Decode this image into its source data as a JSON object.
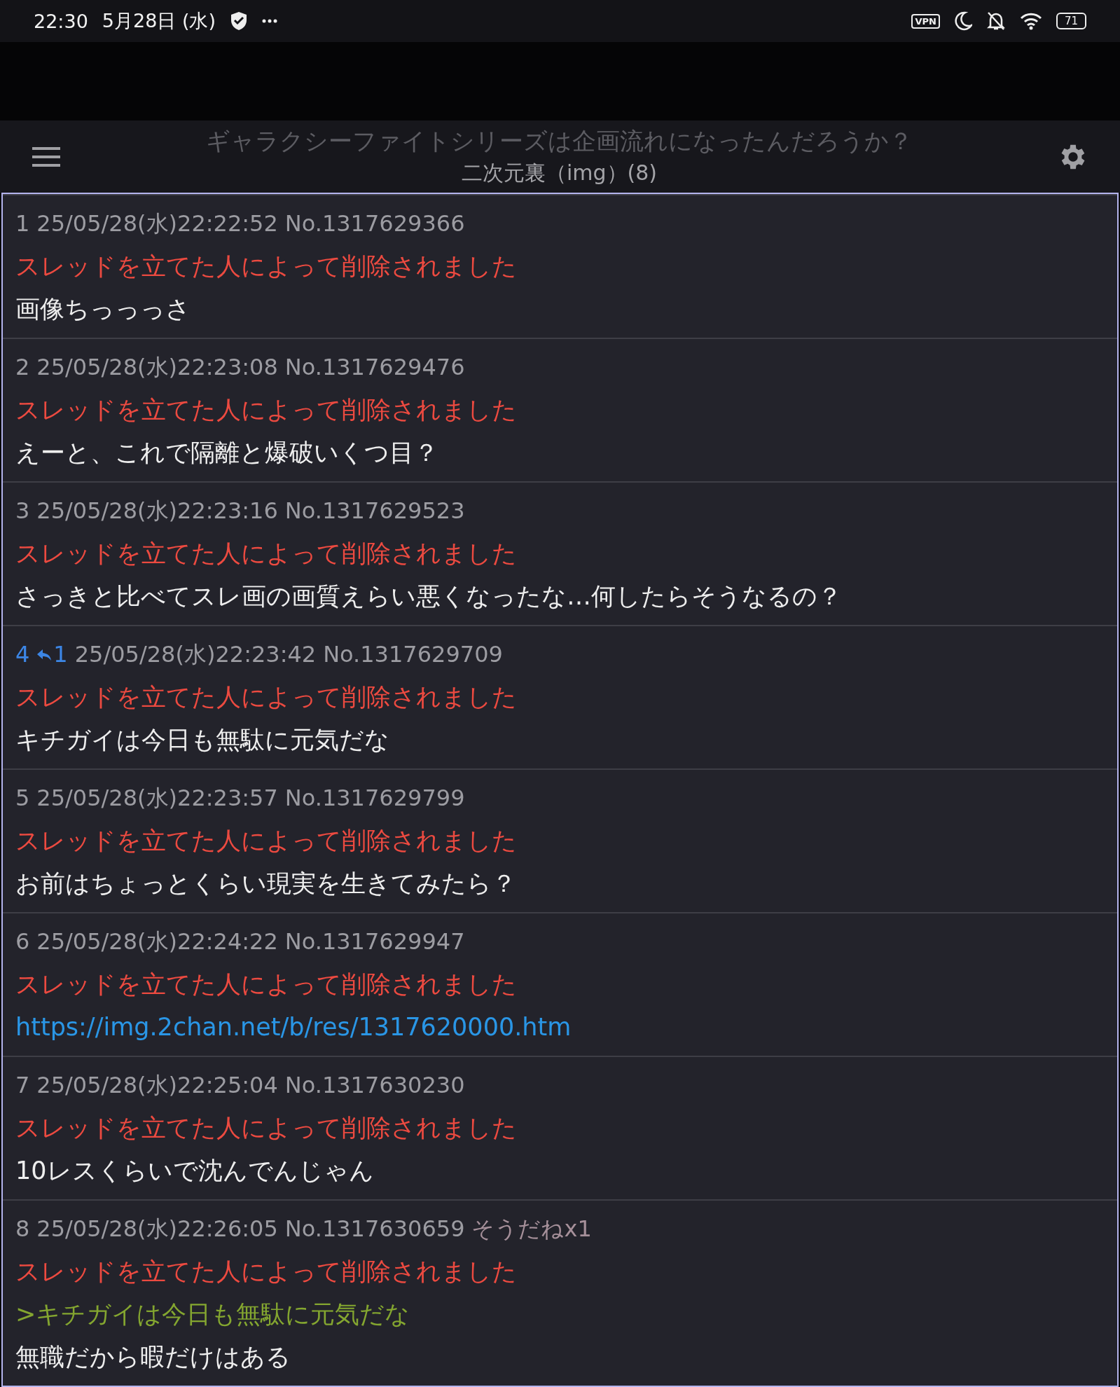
{
  "status_bar": {
    "time": "22:30",
    "date": "5月28日 (水)",
    "vpn": "VPN",
    "battery": "71"
  },
  "header": {
    "title": "ギャラクシーファイトシリーズは企画流れになったんだろうか？",
    "subtitle": "二次元裏（img）(8)"
  },
  "posts": [
    {
      "number": "1",
      "date": "25/05/28(水)22:22:52",
      "no": "No.1317629366",
      "lines": [
        {
          "kind": "deleted",
          "text": "スレッドを立てた人によって削除されました"
        },
        {
          "kind": "text",
          "text": "画像ちっっっさ"
        }
      ]
    },
    {
      "number": "2",
      "date": "25/05/28(水)22:23:08",
      "no": "No.1317629476",
      "lines": [
        {
          "kind": "deleted",
          "text": "スレッドを立てた人によって削除されました"
        },
        {
          "kind": "text",
          "text": "えーと、これで隔離と爆破いくつ目？"
        }
      ]
    },
    {
      "number": "3",
      "date": "25/05/28(水)22:23:16",
      "no": "No.1317629523",
      "lines": [
        {
          "kind": "deleted",
          "text": "スレッドを立てた人によって削除されました"
        },
        {
          "kind": "text",
          "text": "さっきと比べてスレ画の画質えらい悪くなったな…何したらそうなるの？"
        }
      ]
    },
    {
      "number": "4",
      "reply_count": "1",
      "date": "25/05/28(水)22:23:42",
      "no": "No.1317629709",
      "lines": [
        {
          "kind": "deleted",
          "text": "スレッドを立てた人によって削除されました"
        },
        {
          "kind": "text",
          "text": "キチガイは今日も無駄に元気だな"
        }
      ]
    },
    {
      "number": "5",
      "date": "25/05/28(水)22:23:57",
      "no": "No.1317629799",
      "lines": [
        {
          "kind": "deleted",
          "text": "スレッドを立てた人によって削除されました"
        },
        {
          "kind": "text",
          "text": "お前はちょっとくらい現実を生きてみたら？"
        }
      ]
    },
    {
      "number": "6",
      "date": "25/05/28(水)22:24:22",
      "no": "No.1317629947",
      "lines": [
        {
          "kind": "deleted",
          "text": "スレッドを立てた人によって削除されました"
        },
        {
          "kind": "link",
          "text": "https://img.2chan.net/b/res/1317620000.htm"
        }
      ]
    },
    {
      "number": "7",
      "date": "25/05/28(水)22:25:04",
      "no": "No.1317630230",
      "lines": [
        {
          "kind": "deleted",
          "text": "スレッドを立てた人によって削除されました"
        },
        {
          "kind": "text",
          "text": "10レスくらいで沈んでんじゃん"
        }
      ]
    },
    {
      "number": "8",
      "date": "25/05/28(水)22:26:05",
      "no": "No.1317630659",
      "soudane": "そうだねx1",
      "lines": [
        {
          "kind": "deleted",
          "text": "スレッドを立てた人によって削除されました"
        },
        {
          "kind": "quote",
          "text": ">キチガイは今日も無駄に元気だな"
        },
        {
          "kind": "text",
          "text": "無職だから暇だけはある"
        }
      ]
    }
  ]
}
